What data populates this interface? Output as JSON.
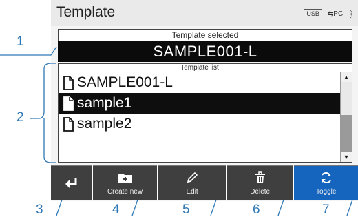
{
  "screen": {
    "title": "Template",
    "status": {
      "usb": "USB",
      "pc": "PC"
    }
  },
  "selected": {
    "label": "Template selected",
    "value": "SAMPLE001-L"
  },
  "template_list": {
    "label": "Template list",
    "items": [
      {
        "name": "SAMPLE001-L",
        "selected": false
      },
      {
        "name": "sample1",
        "selected": true
      },
      {
        "name": "sample2",
        "selected": false
      }
    ]
  },
  "toolbar": {
    "back_label": "",
    "create_label": "Create new",
    "edit_label": "Edit",
    "delete_label": "Delete",
    "toggle_label": "Toggle"
  },
  "callouts": [
    "1",
    "2",
    "3",
    "4",
    "5",
    "6",
    "7"
  ],
  "colors": {
    "callout": "#2f78b6",
    "toolbar_button": "#3f3f3f",
    "toggle_button": "#1564bd",
    "selection": "#0e0e0e"
  }
}
